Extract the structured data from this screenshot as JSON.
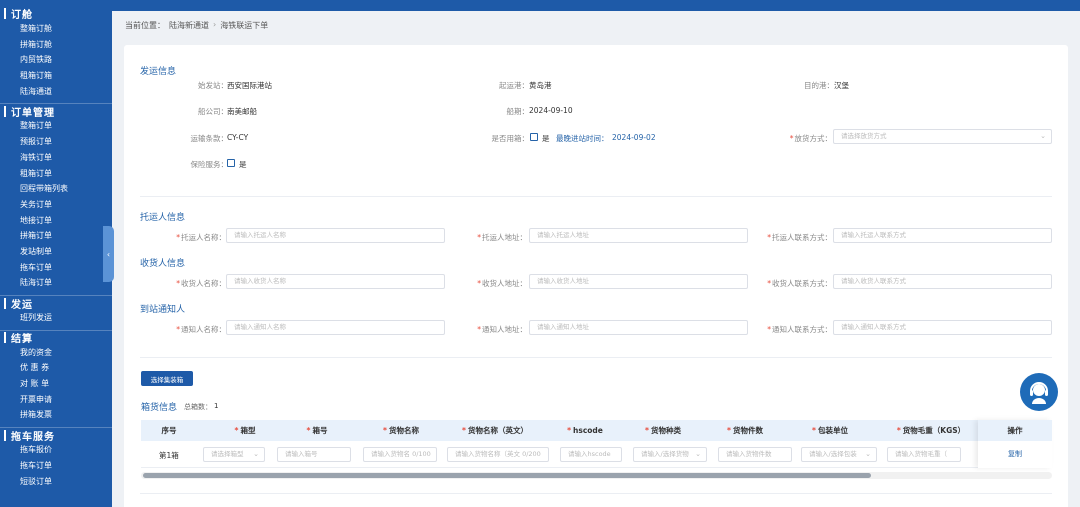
{
  "sidebar": {
    "sections": [
      {
        "title": "订舱",
        "items": [
          "整箱订舱",
          "拼箱订舱",
          "内贸铁路",
          "租箱订箱",
          "陆海通道"
        ]
      },
      {
        "title": "订单管理",
        "items": [
          "整箱订单",
          "预报订单",
          "海铁订单",
          "租箱订单",
          "回程带箱列表",
          "关务订单",
          "地接订单",
          "拼箱订单",
          "发站制单",
          "拖车订单",
          "陆海订单"
        ]
      },
      {
        "title": "发运",
        "items": [
          "班列发运"
        ]
      },
      {
        "title": "结算",
        "items": [
          "我的资金",
          "优 惠 券",
          "对 账 单",
          "开票申请",
          "拼箱发票"
        ]
      },
      {
        "title": "拖车服务",
        "items": [
          "拖车报价",
          "拖车订单",
          "短驳订单"
        ]
      }
    ],
    "collapse_icon": "chevron-left-icon"
  },
  "breadcrumb": {
    "label": "当前位置：",
    "items": [
      "陆海新通道",
      "海铁联运下单"
    ]
  },
  "shipping": {
    "title": "发运信息",
    "origin_label": "始发站：",
    "origin": "西安国际港站",
    "port_label": "起运港：",
    "port": "黄岛港",
    "dest_label": "目的港：",
    "dest": "汉堡",
    "carrier_label": "船公司：",
    "carrier": "南美邮船",
    "schedule_label": "船期：",
    "schedule": "2024-09-10",
    "terms_label": "运输条款：",
    "terms": "CY-CY",
    "rent_label": "是否用箱：",
    "rent_yes": "是",
    "last_in_label": "最晚进站时间：",
    "last_in": "2024-09-02",
    "release_label": "放货方式：",
    "release_placeholder": "请选择放货方式",
    "insurance_label": "保险服务：",
    "insurance_yes": "是"
  },
  "shipper": {
    "title": "托运人信息",
    "name_label": "托运人名称：",
    "name_ph": "请输入托运人名称",
    "addr_label": "托运人地址：",
    "addr_ph": "请输入托运人地址",
    "contact_label": "托运人联系方式：",
    "contact_ph": "请输入托运人联系方式"
  },
  "consignee": {
    "title": "收货人信息",
    "name_label": "收货人名称：",
    "name_ph": "请输入收货人名称",
    "addr_label": "收货人地址：",
    "addr_ph": "请输入收货人地址",
    "contact_label": "收货人联系方式：",
    "contact_ph": "请输入收货人联系方式"
  },
  "notify": {
    "title": "到站通知人",
    "name_label": "通知人名称：",
    "name_ph": "请输入通知人名称",
    "addr_label": "通知人地址：",
    "addr_ph": "请输入通知人地址",
    "contact_label": "通知人联系方式：",
    "contact_ph": "请输入通知人联系方式"
  },
  "containers": {
    "select_button": "选择集装箱",
    "title": "箱货信息",
    "count_label": "总箱数：",
    "count": "1",
    "headers": [
      "序号",
      "箱型",
      "箱号",
      "货物名称",
      "货物名称（英文）",
      "hscode",
      "货物种类",
      "货物件数",
      "包装单位",
      "货物毛重（KGS）"
    ],
    "operation_header": "操作",
    "row": {
      "index": "第1箱",
      "type_ph": "请选择箱型",
      "no_ph": "请输入箱号",
      "name_ph": "请输入货物名 0/100",
      "name_en_ph": "请输入货物名称（英文 0/200",
      "hscode_ph": "请输入hscode",
      "category_ph": "请输入/选择货物",
      "pieces_ph": "请输入货物件数",
      "unit_ph": "请输入/选择包装",
      "weight_ph": "请输入货物毛重（"
    },
    "copy_label": "复制"
  },
  "support_icon": "customer-service-icon"
}
